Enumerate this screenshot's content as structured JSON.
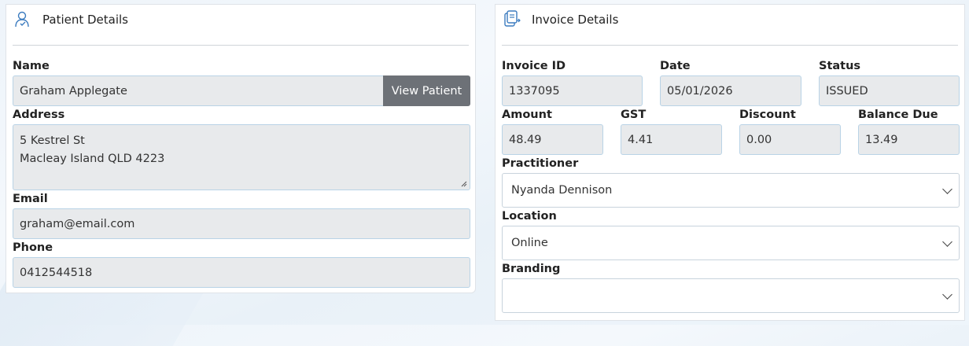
{
  "patient": {
    "title": "Patient Details",
    "icon": "user-icon",
    "name_label": "Name",
    "name_value": "Graham Applegate",
    "view_button": "View Patient",
    "address_label": "Address",
    "address_line1": "5 Kestrel St",
    "address_line2": "Macleay Island QLD 4223",
    "email_label": "Email",
    "email_value": "graham@email.com",
    "phone_label": "Phone",
    "phone_value": "0412544518"
  },
  "invoice": {
    "title": "Invoice Details",
    "icon": "invoice-icon",
    "invoice_id_label": "Invoice ID",
    "invoice_id_value": "1337095",
    "date_label": "Date",
    "date_value": "05/01/2026",
    "status_label": "Status",
    "status_value": "ISSUED",
    "amount_label": "Amount",
    "amount_value": "48.49",
    "gst_label": "GST",
    "gst_value": "4.41",
    "discount_label": "Discount",
    "discount_value": "0.00",
    "balance_label": "Balance Due",
    "balance_value": "13.49",
    "practitioner_label": "Practitioner",
    "practitioner_value": "Nyanda Dennison",
    "location_label": "Location",
    "location_value": "Online",
    "branding_label": "Branding",
    "branding_value": ""
  },
  "colors": {
    "field_bg": "#e8eaec",
    "field_border": "#b9d3e6",
    "button_bg": "#6d7177",
    "icon_blue": "#3b7bbf"
  }
}
